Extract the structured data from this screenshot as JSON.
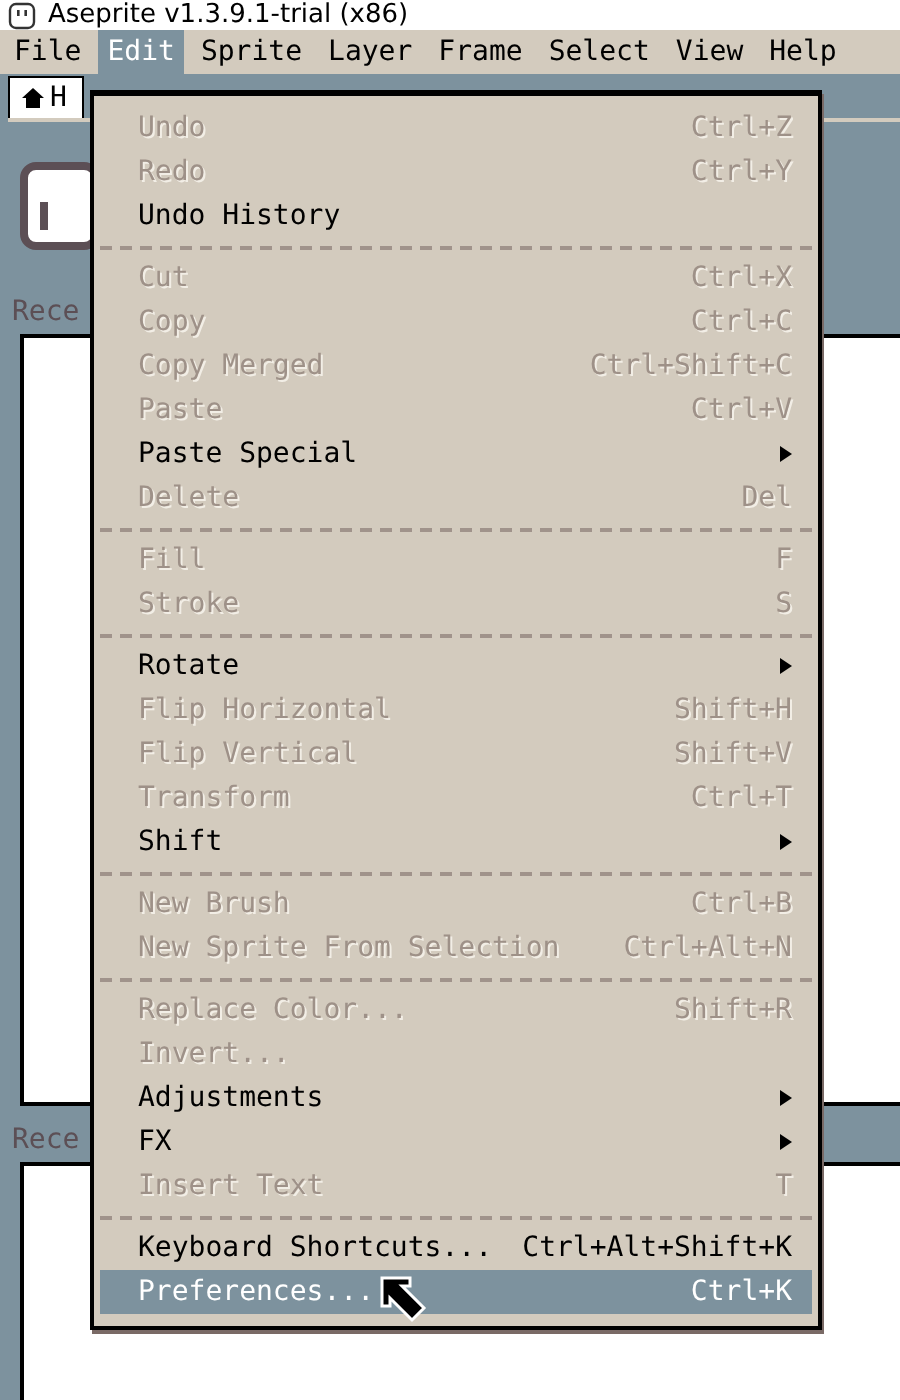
{
  "window": {
    "title": "Aseprite v1.3.9.1-trial (x86)"
  },
  "menubar": [
    {
      "label": "File",
      "selected": false
    },
    {
      "label": "Edit",
      "selected": true
    },
    {
      "label": "Sprite",
      "selected": false
    },
    {
      "label": "Layer",
      "selected": false
    },
    {
      "label": "Frame",
      "selected": false
    },
    {
      "label": "Select",
      "selected": false
    },
    {
      "label": "View",
      "selected": false
    },
    {
      "label": "Help",
      "selected": false
    }
  ],
  "tab": {
    "label": "H"
  },
  "sections": [
    {
      "label": "Rece"
    },
    {
      "label": "Rece"
    }
  ],
  "menu": [
    {
      "kind": "item",
      "label": "Undo",
      "shortcut": "Ctrl+Z",
      "disabled": true,
      "submenu": false,
      "selected": false
    },
    {
      "kind": "item",
      "label": "Redo",
      "shortcut": "Ctrl+Y",
      "disabled": true,
      "submenu": false,
      "selected": false
    },
    {
      "kind": "item",
      "label": "Undo History",
      "disabled": false,
      "submenu": false,
      "selected": false
    },
    {
      "kind": "separator"
    },
    {
      "kind": "item",
      "label": "Cut",
      "shortcut": "Ctrl+X",
      "disabled": true,
      "submenu": false,
      "selected": false
    },
    {
      "kind": "item",
      "label": "Copy",
      "shortcut": "Ctrl+C",
      "disabled": true,
      "submenu": false,
      "selected": false
    },
    {
      "kind": "item",
      "label": "Copy Merged",
      "shortcut": "Ctrl+Shift+C",
      "disabled": true,
      "submenu": false,
      "selected": false
    },
    {
      "kind": "item",
      "label": "Paste",
      "shortcut": "Ctrl+V",
      "disabled": true,
      "submenu": false,
      "selected": false
    },
    {
      "kind": "item",
      "label": "Paste Special",
      "disabled": false,
      "submenu": true,
      "selected": false
    },
    {
      "kind": "item",
      "label": "Delete",
      "shortcut": "Del",
      "disabled": true,
      "submenu": false,
      "selected": false
    },
    {
      "kind": "separator"
    },
    {
      "kind": "item",
      "label": "Fill",
      "shortcut": "F",
      "disabled": true,
      "submenu": false,
      "selected": false
    },
    {
      "kind": "item",
      "label": "Stroke",
      "shortcut": "S",
      "disabled": true,
      "submenu": false,
      "selected": false
    },
    {
      "kind": "separator"
    },
    {
      "kind": "item",
      "label": "Rotate",
      "disabled": false,
      "submenu": true,
      "selected": false
    },
    {
      "kind": "item",
      "label": "Flip Horizontal",
      "shortcut": "Shift+H",
      "disabled": true,
      "submenu": false,
      "selected": false
    },
    {
      "kind": "item",
      "label": "Flip Vertical",
      "shortcut": "Shift+V",
      "disabled": true,
      "submenu": false,
      "selected": false
    },
    {
      "kind": "item",
      "label": "Transform",
      "shortcut": "Ctrl+T",
      "disabled": true,
      "submenu": false,
      "selected": false
    },
    {
      "kind": "item",
      "label": "Shift",
      "disabled": false,
      "submenu": true,
      "selected": false
    },
    {
      "kind": "separator"
    },
    {
      "kind": "item",
      "label": "New Brush",
      "shortcut": "Ctrl+B",
      "disabled": true,
      "submenu": false,
      "selected": false
    },
    {
      "kind": "item",
      "label": "New Sprite From Selection",
      "shortcut": "Ctrl+Alt+N",
      "disabled": true,
      "submenu": false,
      "selected": false
    },
    {
      "kind": "separator"
    },
    {
      "kind": "item",
      "label": "Replace Color...",
      "shortcut": "Shift+R",
      "disabled": true,
      "submenu": false,
      "selected": false
    },
    {
      "kind": "item",
      "label": "Invert...",
      "disabled": true,
      "submenu": false,
      "selected": false
    },
    {
      "kind": "item",
      "label": "Adjustments",
      "disabled": false,
      "submenu": true,
      "selected": false
    },
    {
      "kind": "item",
      "label": "FX",
      "disabled": false,
      "submenu": true,
      "selected": false
    },
    {
      "kind": "item",
      "label": "Insert Text",
      "shortcut": "T",
      "disabled": true,
      "submenu": false,
      "selected": false
    },
    {
      "kind": "separator"
    },
    {
      "kind": "item",
      "label": "Keyboard Shortcuts...",
      "shortcut": "Ctrl+Alt+Shift+K",
      "disabled": false,
      "submenu": false,
      "selected": false
    },
    {
      "kind": "item",
      "label": "Preferences...",
      "shortcut": "Ctrl+K",
      "disabled": false,
      "submenu": false,
      "selected": true
    }
  ]
}
